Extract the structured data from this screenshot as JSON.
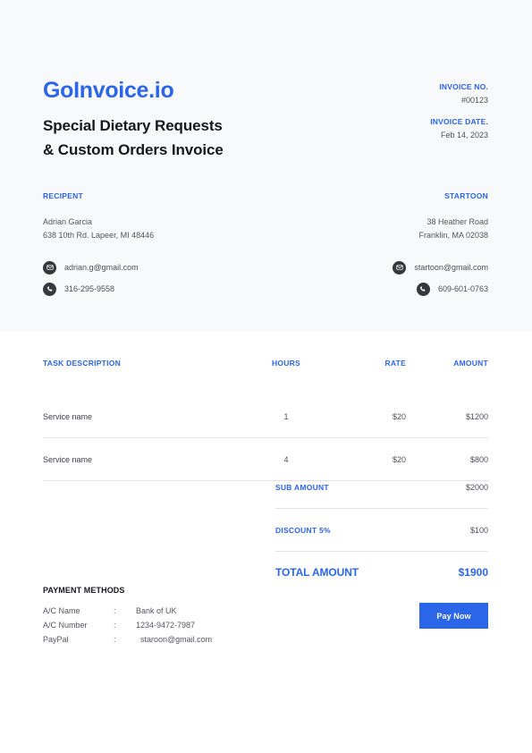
{
  "brand": "GoInvoice.io",
  "document_title": "Special Dietary Requests & Custom Orders Invoice",
  "accent_color": "#2b65e8",
  "meta": {
    "number_label": "INVOICE NO.",
    "number_value": "#00123",
    "date_label": "INVOICE DATE.",
    "date_value": "Feb 14, 2023"
  },
  "recipient": {
    "heading": "RECIPENT",
    "name": "Adrian Garcia",
    "address": "638 10th Rd.  Lapeer, MI 48446",
    "email": "adrian.g@gmail.com",
    "phone": "316-295-9558"
  },
  "sender": {
    "heading": "STARTOON",
    "address_line1": "38 Heather Road",
    "address_line2": "Franklin, MA 02038",
    "email": "startoon@gmail.com",
    "phone": "609-601-0763"
  },
  "table": {
    "headers": {
      "description": "TASK DESCRIPTION",
      "hours": "HOURS",
      "rate": "RATE",
      "amount": "AMOUNT"
    },
    "rows": [
      {
        "description": "Service name",
        "hours": "1",
        "rate": "$20",
        "amount": "$1200"
      },
      {
        "description": "Service name",
        "hours": "4",
        "rate": "$20",
        "amount": "$800"
      }
    ]
  },
  "totals": {
    "sub_label": "SUB AMOUNT",
    "sub_value": "$2000",
    "discount_label": "DISCOUNT 5%",
    "discount_value": "$100",
    "total_label": "TOTAL AMOUNT",
    "total_value": "$1900"
  },
  "payment": {
    "heading": "PAYMENT METHODS",
    "separator": ":",
    "rows": [
      {
        "key": "A/C Name",
        "value": "Bank of UK"
      },
      {
        "key": "A/C Number",
        "value": "1234-9472-7987"
      },
      {
        "key": "PayPal",
        "value": "  staroon@gmail.com"
      }
    ]
  },
  "actions": {
    "pay_now": "Pay Now"
  }
}
